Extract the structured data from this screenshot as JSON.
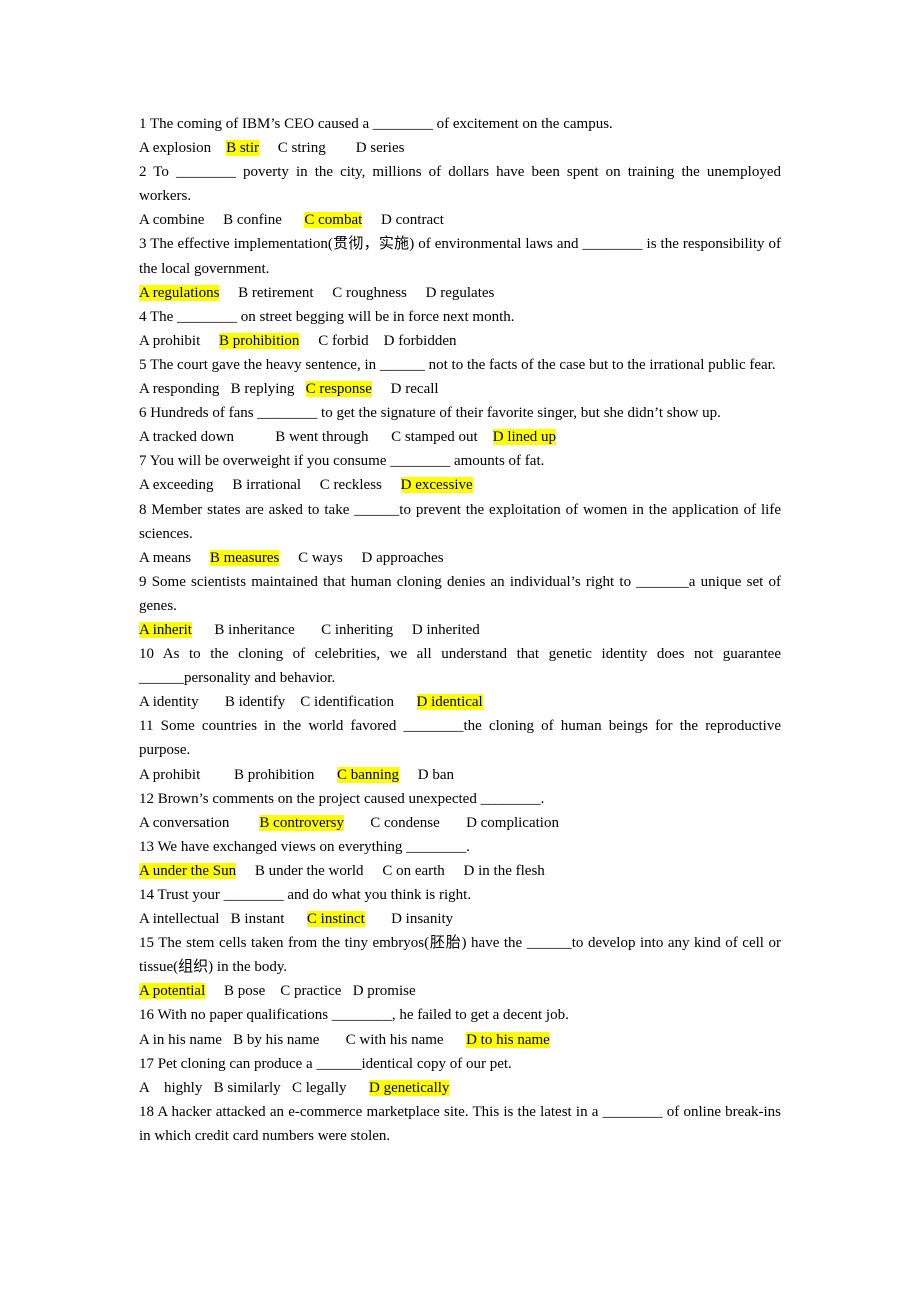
{
  "questions": [
    {
      "number": "1",
      "text": "1 The coming of IBM’s CEO caused a ________ of excitement on the campus.",
      "options": [
        {
          "label": "A explosion",
          "answer": false
        },
        {
          "label": "B stir",
          "answer": true
        },
        {
          "label": "C string",
          "answer": false
        },
        {
          "label": "D series",
          "answer": false
        }
      ],
      "gaps": [
        "    ",
        "     ",
        "        "
      ]
    },
    {
      "number": "2",
      "text": "2 To ________ poverty in the city, millions of dollars have been spent on training the unemployed workers.",
      "options": [
        {
          "label": "A combine",
          "answer": false
        },
        {
          "label": "B confine",
          "answer": false
        },
        {
          "label": "C combat",
          "answer": true
        },
        {
          "label": "D contract",
          "answer": false
        }
      ],
      "gaps": [
        "     ",
        "      ",
        "     "
      ]
    },
    {
      "number": "3",
      "text": "3 The effective implementation(贯彻，实施) of environmental laws and ________ is the responsibility of the local government.",
      "options": [
        {
          "label": "A regulations",
          "answer": true
        },
        {
          "label": "B retirement",
          "answer": false
        },
        {
          "label": "C roughness",
          "answer": false
        },
        {
          "label": "D regulates",
          "answer": false
        }
      ],
      "gaps": [
        "     ",
        "     ",
        "     "
      ]
    },
    {
      "number": "4",
      "text": "4 The ________ on street begging will be in force next month.",
      "options": [
        {
          "label": "A prohibit",
          "answer": false
        },
        {
          "label": "B prohibition",
          "answer": true
        },
        {
          "label": "C forbid",
          "answer": false
        },
        {
          "label": "D forbidden",
          "answer": false
        }
      ],
      "gaps": [
        "     ",
        "     ",
        "    "
      ]
    },
    {
      "number": "5",
      "text": "5 The court gave the heavy sentence, in ______ not to the facts of the case but to the irrational public fear.",
      "options": [
        {
          "label": "A responding",
          "answer": false
        },
        {
          "label": "B replying",
          "answer": false
        },
        {
          "label": "C response",
          "answer": true
        },
        {
          "label": "D recall",
          "answer": false
        }
      ],
      "gaps": [
        "   ",
        "   ",
        "     "
      ]
    },
    {
      "number": "6",
      "text": "6 Hundreds of fans ________ to get the signature of their favorite singer, but she didn’t show up.",
      "options": [
        {
          "label": "A tracked down",
          "answer": false
        },
        {
          "label": "B went through",
          "answer": false
        },
        {
          "label": "C stamped out",
          "answer": false
        },
        {
          "label": "D lined up",
          "answer": true
        }
      ],
      "gaps": [
        "           ",
        "      ",
        "    "
      ]
    },
    {
      "number": "7",
      "text": "7 You will be overweight if you consume ________ amounts of fat.",
      "options": [
        {
          "label": "A exceeding",
          "answer": false
        },
        {
          "label": "B irrational",
          "answer": false
        },
        {
          "label": "C reckless",
          "answer": false
        },
        {
          "label": "D excessive",
          "answer": true
        }
      ],
      "gaps": [
        "     ",
        "     ",
        "     "
      ]
    },
    {
      "number": "8",
      "text": "8 Member states are asked to take ______to prevent the exploitation of women in the application of life sciences.",
      "options": [
        {
          "label": "A means",
          "answer": false
        },
        {
          "label": "B measures",
          "answer": true
        },
        {
          "label": "C ways",
          "answer": false
        },
        {
          "label": "D approaches",
          "answer": false
        }
      ],
      "gaps": [
        "     ",
        "     ",
        "     "
      ]
    },
    {
      "number": "9",
      "text": "9 Some scientists maintained that human cloning denies an individual’s right to _______a unique set of genes.",
      "options": [
        {
          "label": "A inherit",
          "answer": true
        },
        {
          "label": "B inheritance",
          "answer": false
        },
        {
          "label": "C inheriting",
          "answer": false
        },
        {
          "label": "D inherited",
          "answer": false
        }
      ],
      "gaps": [
        "      ",
        "       ",
        "     "
      ]
    },
    {
      "number": "10",
      "text": "10 As to the cloning of celebrities, we all understand that genetic identity does not guarantee ______personality and behavior.",
      "options": [
        {
          "label": "A identity",
          "answer": false
        },
        {
          "label": "B identify",
          "answer": false
        },
        {
          "label": "C identification",
          "answer": false
        },
        {
          "label": "D identical",
          "answer": true
        }
      ],
      "gaps": [
        "       ",
        "    ",
        "      "
      ]
    },
    {
      "number": "11",
      "text": "11 Some countries in the world favored ________the cloning of human beings for the reproductive purpose.",
      "options": [
        {
          "label": "A prohibit",
          "answer": false
        },
        {
          "label": "B prohibition",
          "answer": false
        },
        {
          "label": "C banning",
          "answer": true
        },
        {
          "label": "D ban",
          "answer": false
        }
      ],
      "gaps": [
        "         ",
        "      ",
        "     "
      ]
    },
    {
      "number": "12",
      "text": "12 Brown’s comments on the project caused unexpected ________.",
      "options": [
        {
          "label": "A conversation",
          "answer": false
        },
        {
          "label": "B controversy",
          "answer": true
        },
        {
          "label": "C condense",
          "answer": false
        },
        {
          "label": "D complication",
          "answer": false
        }
      ],
      "gaps": [
        "        ",
        "       ",
        "       "
      ]
    },
    {
      "number": "13",
      "text": "13 We have exchanged views on everything ________.",
      "options": [
        {
          "label": "A under the Sun",
          "answer": true
        },
        {
          "label": "B under the world",
          "answer": false
        },
        {
          "label": "C on earth",
          "answer": false
        },
        {
          "label": "D in the flesh",
          "answer": false
        }
      ],
      "gaps": [
        "     ",
        "     ",
        "     "
      ]
    },
    {
      "number": "14",
      "text": "14 Trust your ________ and do what you think is right.",
      "options": [
        {
          "label": "A intellectual",
          "answer": false
        },
        {
          "label": "B instant",
          "answer": false
        },
        {
          "label": "C instinct",
          "answer": true
        },
        {
          "label": "D insanity",
          "answer": false
        }
      ],
      "gaps": [
        "   ",
        "      ",
        "       "
      ]
    },
    {
      "number": "15",
      "text": "15 The stem cells taken from the tiny embryos(胚胎) have the ______to develop into any kind of cell or tissue(组织) in the body.",
      "options": [
        {
          "label": "A potential",
          "answer": true
        },
        {
          "label": "B pose",
          "answer": false
        },
        {
          "label": "C practice",
          "answer": false
        },
        {
          "label": "D promise",
          "answer": false
        }
      ],
      "gaps": [
        "     ",
        "    ",
        "   "
      ]
    },
    {
      "number": "16",
      "text": "16 With no paper qualifications ________, he failed to get a decent job.",
      "options": [
        {
          "label": "A in his name",
          "answer": false
        },
        {
          "label": "B by his name",
          "answer": false
        },
        {
          "label": "C with his name",
          "answer": false
        },
        {
          "label": "D to his name",
          "answer": true
        }
      ],
      "gaps": [
        "   ",
        "       ",
        "      "
      ]
    },
    {
      "number": "17",
      "text": "17 Pet cloning can produce a ______identical copy of our pet.",
      "options": [
        {
          "label": "A    highly",
          "answer": false
        },
        {
          "label": "B similarly",
          "answer": false
        },
        {
          "label": "C legally",
          "answer": false
        },
        {
          "label": "D genetically",
          "answer": true
        }
      ],
      "gaps": [
        "   ",
        "   ",
        "      "
      ]
    },
    {
      "number": "18",
      "text": "18 A hacker attacked an e-commerce marketplace site. This is the latest in a ________ of online break-ins in which credit card numbers were stolen.",
      "options": [],
      "gaps": []
    }
  ],
  "colors": {
    "answer_highlight": "#ffff00",
    "text": "#000000",
    "background": "#ffffff"
  }
}
